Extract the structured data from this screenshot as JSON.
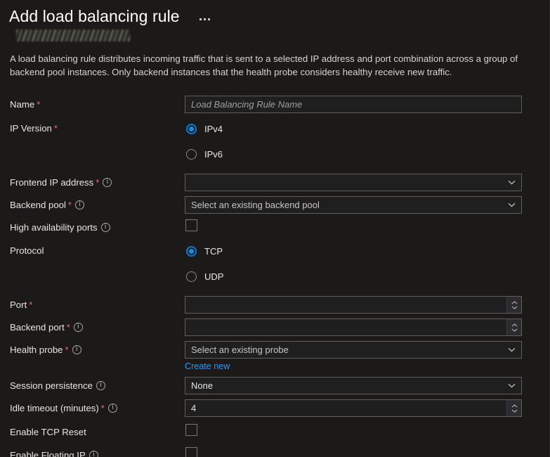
{
  "blade": {
    "title": "Add load balancing rule",
    "more_menu": "more-options",
    "subtitle_redacted": "",
    "description": "A load balancing rule distributes incoming traffic that is sent to a selected IP address and port combination across a group of backend pool instances. Only backend instances that the health probe considers healthy receive new traffic."
  },
  "colors": {
    "background": "#1b1a19",
    "input_background": "#1f1f1f",
    "input_border": "#605e5c",
    "accent": "#0078d4",
    "link": "#2899f5",
    "required_asterisk": "#e36a77",
    "placeholder": "#a19f9d"
  },
  "form": {
    "name": {
      "label": "Name",
      "required": "*",
      "value": "",
      "placeholder": "Load Balancing Rule Name"
    },
    "ip_version": {
      "label": "IP Version",
      "required": "*",
      "selected": "IPv4",
      "options": [
        {
          "label": "IPv4",
          "checked": true
        },
        {
          "label": "IPv6",
          "checked": false
        }
      ]
    },
    "frontend_ip_address": {
      "label": "Frontend IP address",
      "required": "*",
      "info": "info-icon",
      "value": "",
      "placeholder": ""
    },
    "backend_pool": {
      "label": "Backend pool",
      "required": "*",
      "info": "info-icon",
      "value": "Select an existing backend pool"
    },
    "high_availability_ports": {
      "label": "High availability ports",
      "info": "info-icon",
      "checked": false
    },
    "protocol": {
      "label": "Protocol",
      "selected": "TCP",
      "options": [
        {
          "label": "TCP",
          "checked": true
        },
        {
          "label": "UDP",
          "checked": false
        }
      ]
    },
    "port": {
      "label": "Port",
      "required": "*",
      "value": ""
    },
    "backend_port": {
      "label": "Backend port",
      "required": "*",
      "info": "info-icon",
      "value": ""
    },
    "health_probe": {
      "label": "Health probe",
      "required": "*",
      "info": "info-icon",
      "value": "Select an existing probe",
      "create_link": "Create new"
    },
    "session_persistence": {
      "label": "Session persistence",
      "info": "info-icon",
      "value": "None"
    },
    "idle_timeout": {
      "label": "Idle timeout (minutes)",
      "required": "*",
      "info": "info-icon",
      "value": "4"
    },
    "enable_tcp_reset": {
      "label": "Enable TCP Reset",
      "checked": false
    },
    "enable_floating_ip": {
      "label": "Enable Floating IP",
      "info": "info-icon",
      "checked": false
    }
  },
  "icons": {
    "chevron_down": "chevron-down-icon",
    "spinner_up": "spinner-up-icon",
    "spinner_down": "spinner-down-icon",
    "info": "info-icon",
    "ellipsis": "ellipsis-icon"
  }
}
